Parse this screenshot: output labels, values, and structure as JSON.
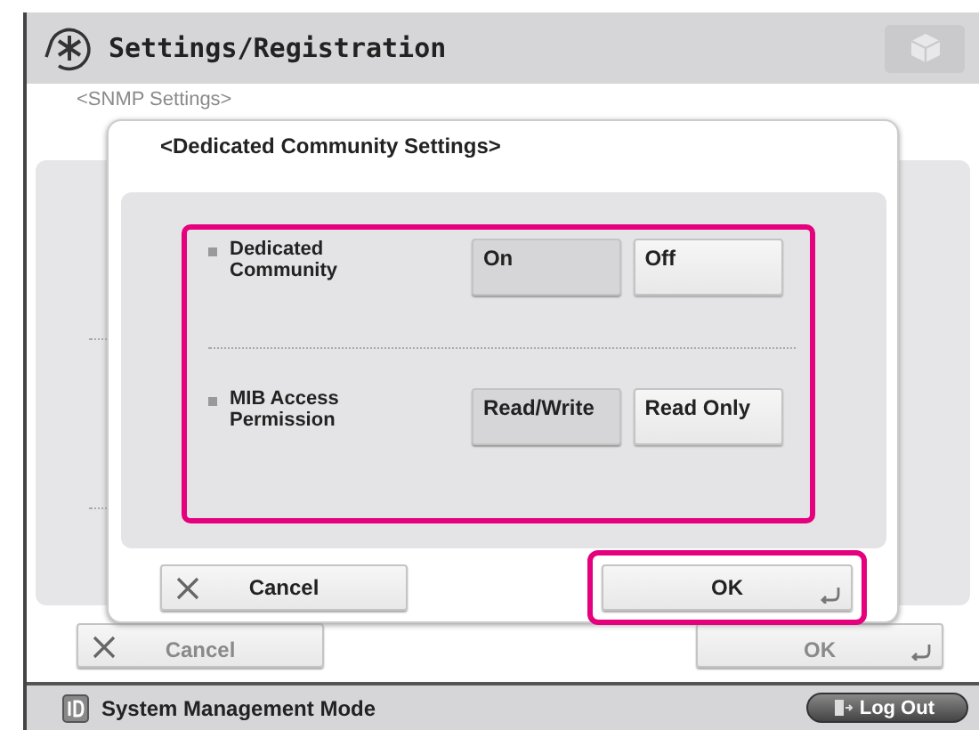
{
  "header": {
    "title": "Settings/Registration"
  },
  "background": {
    "breadcrumb": "<SNMP Settings>",
    "buttons": [
      {
        "label": "Cancel",
        "kind": "cancel"
      },
      {
        "label": "OK",
        "kind": "ok"
      }
    ]
  },
  "dialog": {
    "title": "<Dedicated Community Settings>",
    "settings_highlighted": true,
    "settings": [
      {
        "label": "Dedicated Community",
        "options": [
          {
            "label": "On",
            "selected": true
          },
          {
            "label": "Off",
            "selected": false
          }
        ]
      },
      {
        "label": "MIB Access Permission",
        "options": [
          {
            "label": "Read/Write",
            "selected": true
          },
          {
            "label": "Read Only",
            "selected": false
          }
        ]
      }
    ],
    "buttons": [
      {
        "label": "Cancel",
        "kind": "cancel",
        "highlighted": false
      },
      {
        "label": "OK",
        "kind": "ok",
        "highlighted": true
      }
    ]
  },
  "footer": {
    "mode": "System Management Mode",
    "logout": "Log Out"
  }
}
